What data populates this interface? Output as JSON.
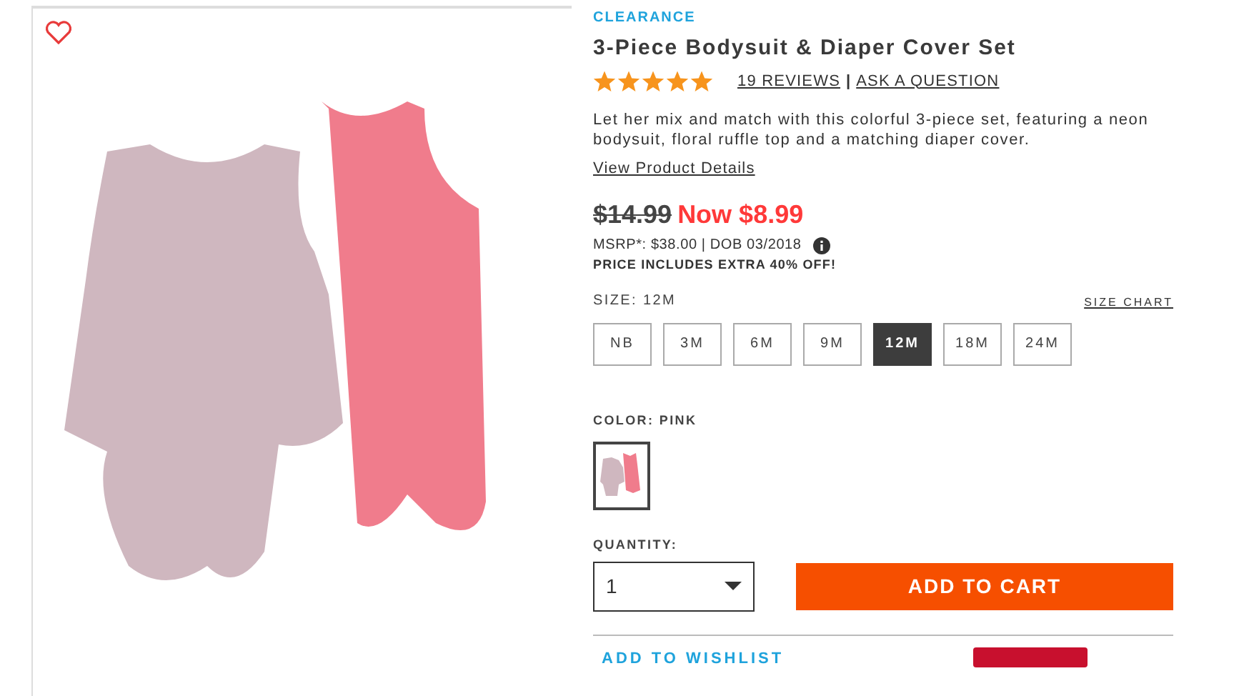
{
  "gallery": {
    "favorite": false
  },
  "product": {
    "badge": "CLEARANCE",
    "title": "3-Piece Bodysuit & Diaper Cover Set",
    "stars": 5,
    "reviews_link": "19 REVIEWS",
    "separator": "|",
    "question_link": "ASK A QUESTION",
    "description": "Let her mix and match with this colorful 3-piece set, featuring a neon bodysuit, floral ruffle top and a matching diaper cover.",
    "details_link": "View Product Details"
  },
  "price": {
    "original": "$14.99",
    "now": "Now $8.99",
    "msrp": "MSRP*: $38.00 | DOB 03/2018",
    "note": "PRICE INCLUDES EXTRA 40% OFF!"
  },
  "size": {
    "label": "SIZE: 12M",
    "chart_link": "SIZE CHART",
    "options": [
      {
        "label": "NB",
        "selected": false
      },
      {
        "label": "3M",
        "selected": false
      },
      {
        "label": "6M",
        "selected": false
      },
      {
        "label": "9M",
        "selected": false
      },
      {
        "label": "12M",
        "selected": true
      },
      {
        "label": "18M",
        "selected": false
      },
      {
        "label": "24M",
        "selected": false
      }
    ]
  },
  "color": {
    "label": "COLOR: PINK",
    "swatches": [
      {
        "selected": true
      }
    ]
  },
  "quantity": {
    "label": "QUANTITY:",
    "value": "1"
  },
  "add_to_cart": "ADD TO CART",
  "wishlist_link": "ADD TO WISHLIST"
}
